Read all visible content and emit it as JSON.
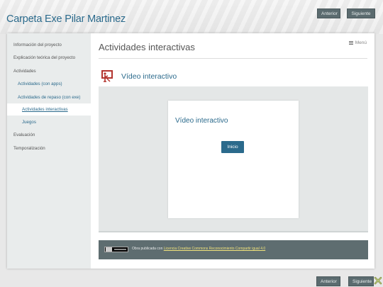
{
  "site": {
    "title": "Carpeta Exe Pilar Martinez"
  },
  "nav": {
    "prev_label": "Anterior",
    "next_label": "Siguiente"
  },
  "sidebar": {
    "items": [
      {
        "label": "Información del proyecto"
      },
      {
        "label": "Explicación teórica del proyecto"
      },
      {
        "label": "Actividades"
      },
      {
        "label": "Actividades (con apps)"
      },
      {
        "label": "Actividades de repaso (con exe)"
      },
      {
        "label": "Actividades interactivas"
      },
      {
        "label": "Juegos"
      },
      {
        "label": "Evaluación"
      },
      {
        "label": "Temporalización"
      }
    ]
  },
  "main": {
    "page_title": "Actividades interactivas",
    "menu_label": "Menú",
    "idevice": {
      "title": "Vídeo interactivo",
      "inner_title": "Vídeo interactivo",
      "start_label": "Inicio"
    }
  },
  "footer": {
    "license_prefix": "Obra publicada con ",
    "license_link": "Licencia Creative Commons Reconocimiento Compartir igual 4.0"
  },
  "colors": {
    "accent": "#2b6a8c",
    "nav_button": "#5b6b6f",
    "license_bar": "#5e6d70",
    "link_yellow": "#f0e27a",
    "icon_red": "#b3342e"
  },
  "icons": {
    "idevice": "presentation-board-icon",
    "menu": "hamburger-icon",
    "close": "close-x-icon",
    "license": "cc-by-sa-badge-icon"
  }
}
